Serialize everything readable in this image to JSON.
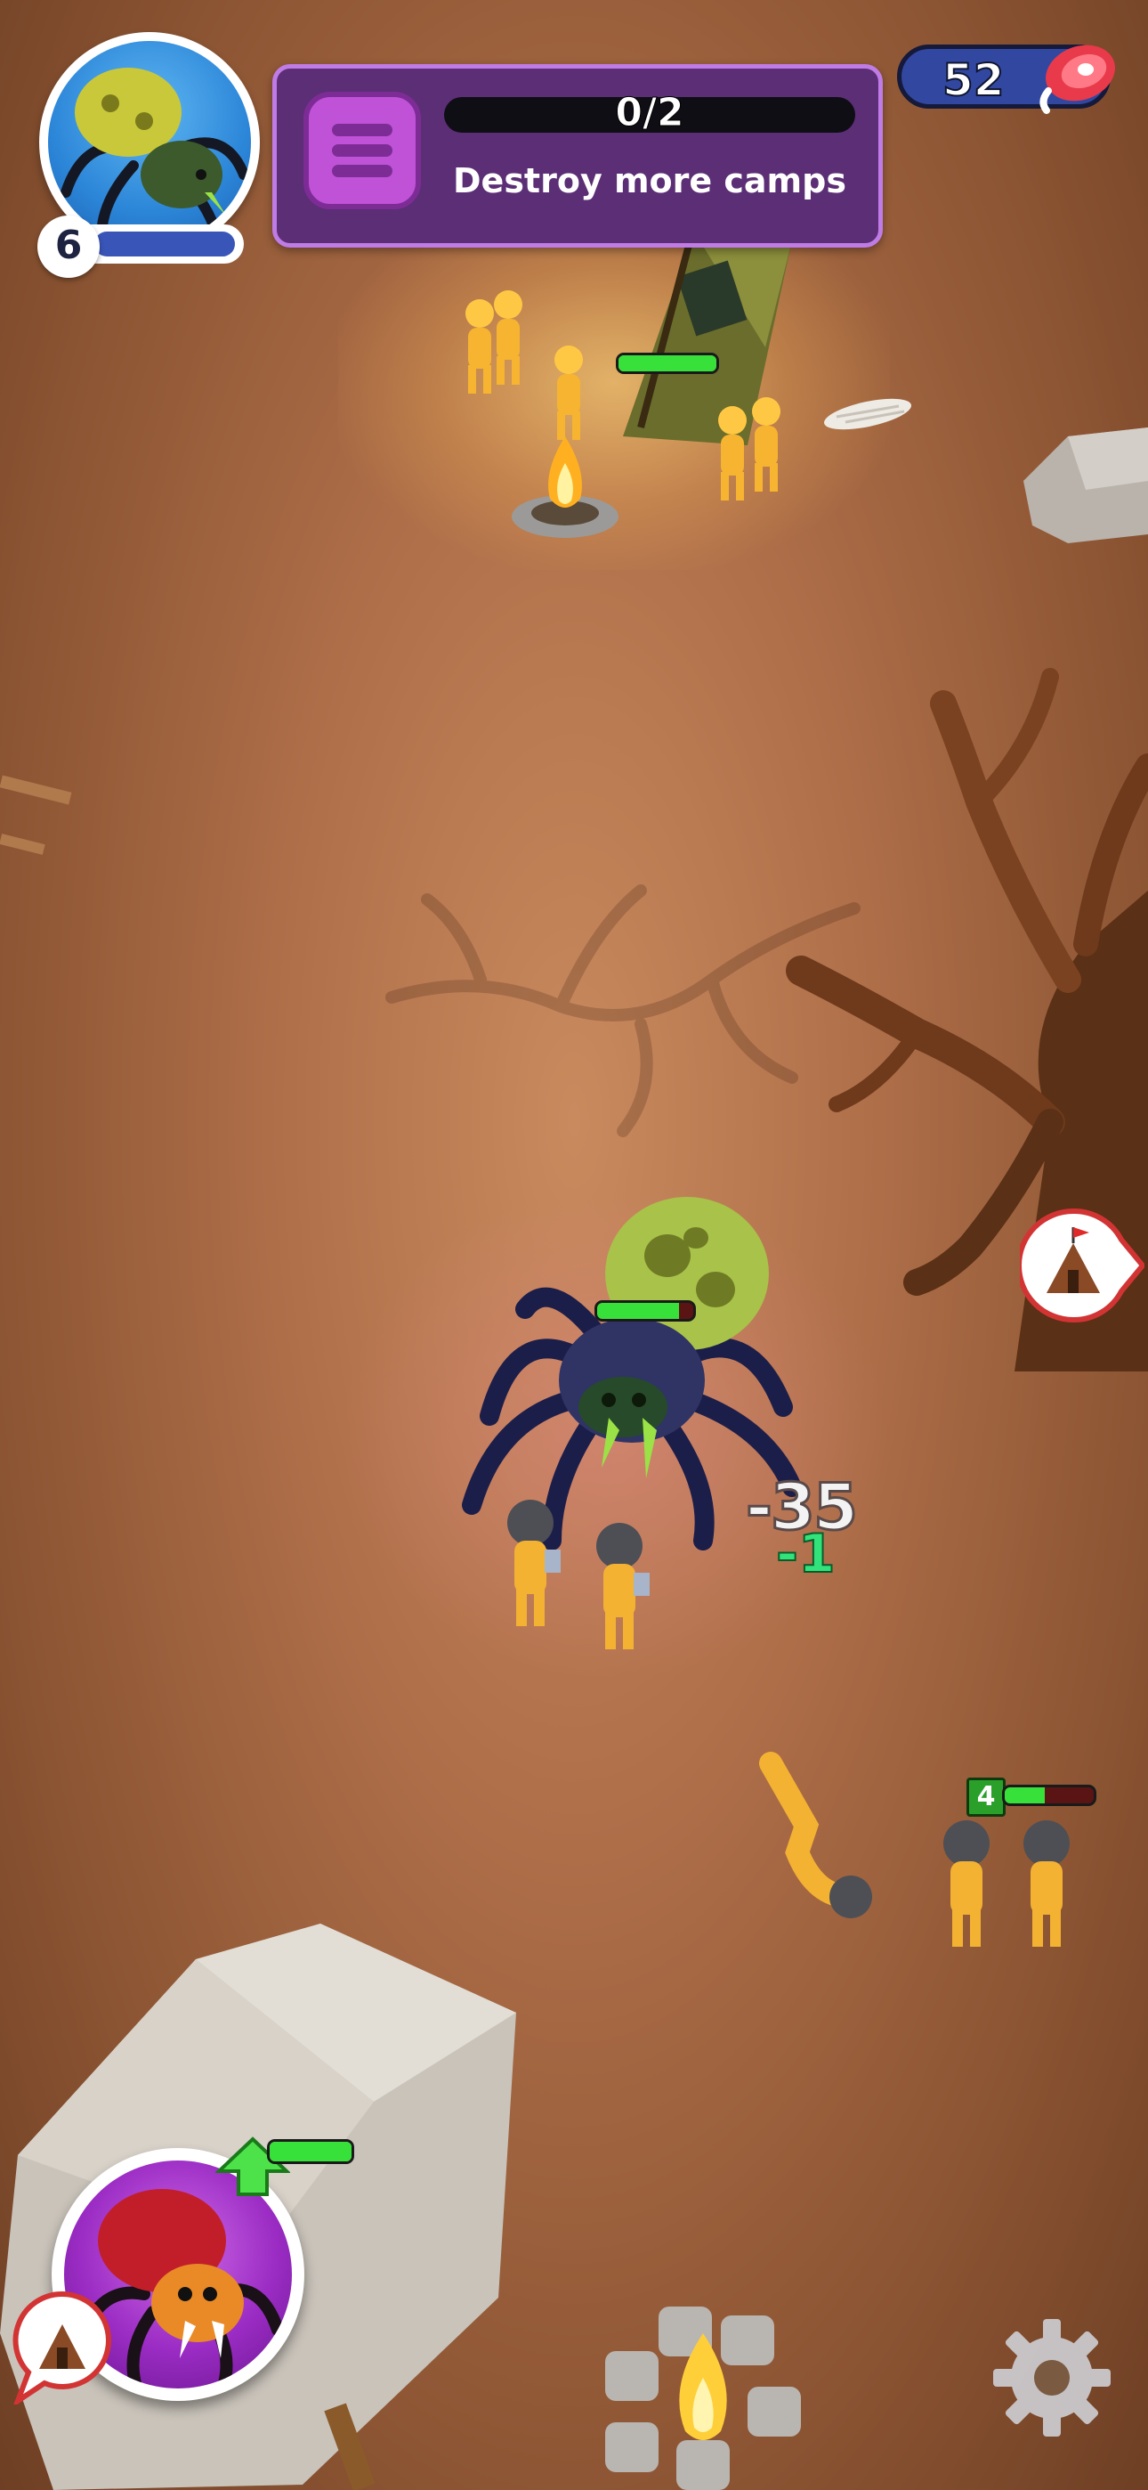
{
  "player": {
    "level": "6",
    "portrait_icon": "spider-icon"
  },
  "quest": {
    "progress": "0/2",
    "progress_fraction": 0.0,
    "objective": "Destroy more camps",
    "icon": "list-icon",
    "accent": "#c07ce6"
  },
  "resources": {
    "meat_count": "52",
    "meat_icon": "meat-icon"
  },
  "combat": {
    "damage_text": "-35",
    "heal_text": "-1",
    "enemy_squad_level": "4"
  },
  "health": {
    "camp": 1.0,
    "spider": 0.85,
    "enemy_squad": 0.45,
    "summon": 1.0
  },
  "controls": {
    "camp_marker_icon": "camp-tent-icon",
    "summon_button_icon": "red-spider-icon",
    "upgrade_icon": "upgrade-arrow-icon",
    "settings_icon": "gear-icon"
  }
}
